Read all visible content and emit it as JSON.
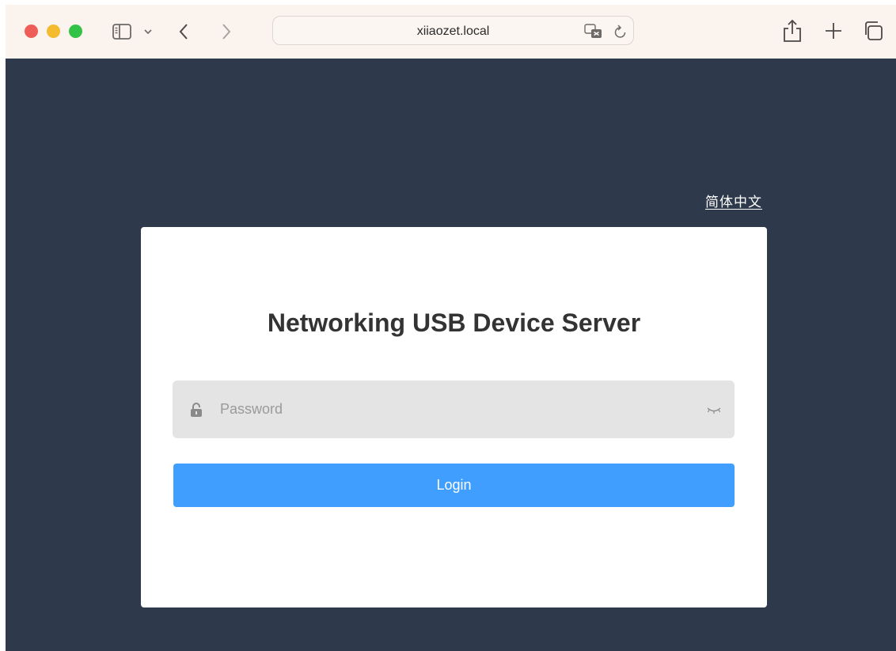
{
  "browser": {
    "address": "xiiaozet.local",
    "icons": [
      "sidebar-icon",
      "chevron-down-icon",
      "back-icon",
      "forward-icon",
      "translate-icon",
      "reload-icon",
      "share-icon",
      "plus-icon",
      "tabs-overview-icon"
    ]
  },
  "page": {
    "language_link": "简体中文",
    "title": "Networking USB Device Server",
    "password": {
      "placeholder": "Password",
      "value": ""
    },
    "login_label": "Login"
  },
  "colors": {
    "background": "#2e3a4b",
    "button": "#409eff",
    "card": "#ffffff",
    "field": "#e4e4e4"
  }
}
